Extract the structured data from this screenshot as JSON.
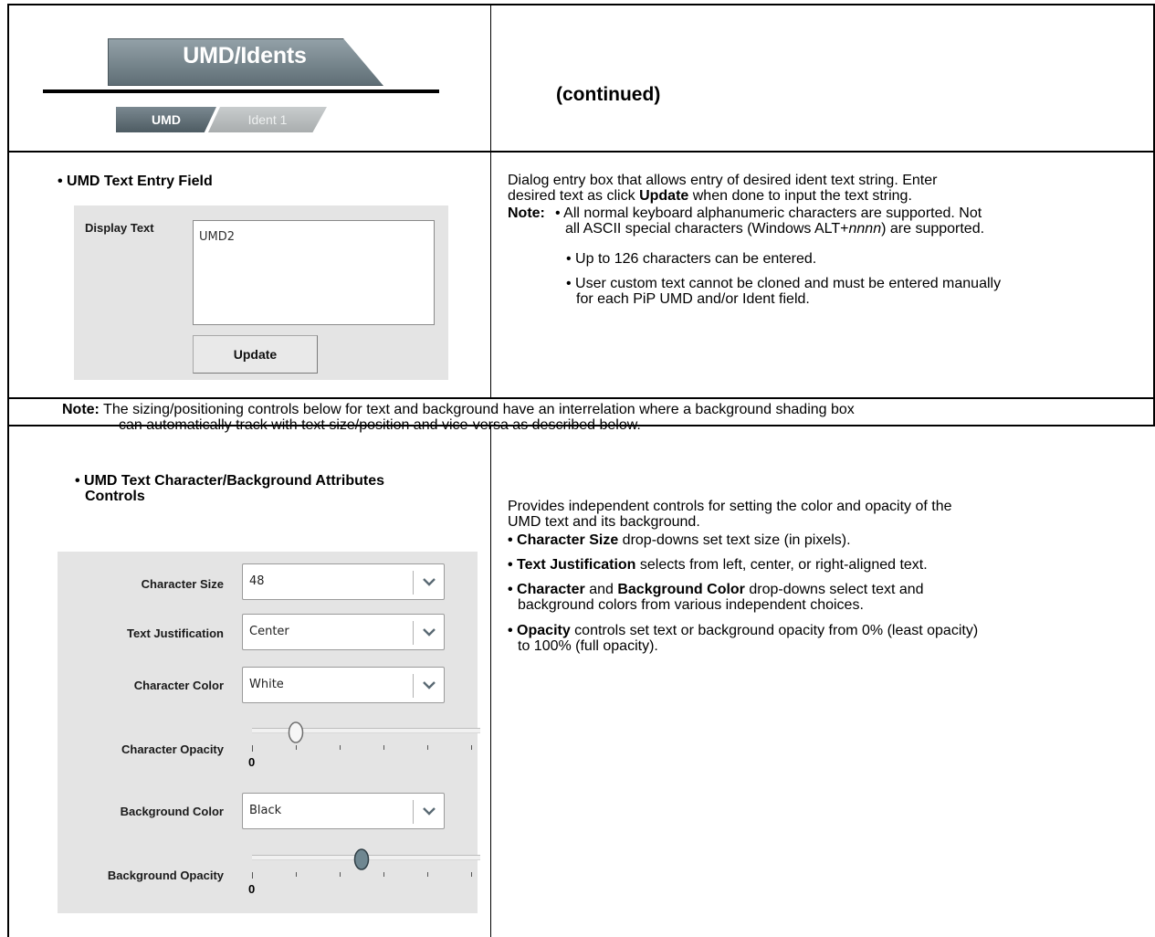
{
  "header": {
    "main_tab": "UMD/Idents",
    "sub_tabs": [
      "UMD",
      "Ident 1"
    ],
    "continued": "(continued)"
  },
  "section1": {
    "title": "• UMD Text Entry Field",
    "field_label": "Display Text",
    "field_value": "UMD2",
    "button": "Update",
    "desc_intro_1": "Dialog entry box that allows entry of desired ident text string. Enter",
    "desc_intro_2a": "desired text as click ",
    "desc_intro_2b": "Update",
    "desc_intro_2c": " when done to input the text string.",
    "note_label": "Note:",
    "note_1a": "• All normal keyboard alphanumeric characters are supported. Not",
    "note_1b_a": "all ASCII special characters (Windows ALT+",
    "note_1b_b": "nnnn",
    "note_1b_c": ") are supported.",
    "note_2": "• Up to 126 characters can be entered.",
    "note_3a": "• User custom text cannot be cloned and must be entered manually",
    "note_3b": "for each PiP UMD and/or Ident field."
  },
  "note_row": {
    "label": "Note:",
    "line1": " The sizing/positioning controls below for text and background have an interrelation where a background shading box",
    "line2": "can automatically track with text size/position and vice-versa as described below."
  },
  "section3": {
    "title_1": "• UMD Text Character/Background Attributes",
    "title_2": "Controls",
    "controls": {
      "char_size": {
        "label": "Character Size",
        "value": "48"
      },
      "text_just": {
        "label": "Text Justification",
        "value": "Center"
      },
      "char_color": {
        "label": "Character Color",
        "value": "White"
      },
      "char_opacity": {
        "label": "Character Opacity",
        "min_label": "0",
        "level_percent": 20
      },
      "bg_color": {
        "label": "Background Color",
        "value": "Black"
      },
      "bg_opacity": {
        "label": "Background Opacity",
        "min_label": "0",
        "level_percent": 50
      }
    },
    "desc_1": "Provides independent controls for setting the color and opacity of the",
    "desc_2": "UMD text and its background.",
    "b1_bold": "• Character Size",
    "b1_rest": " drop-downs set text size (in pixels).",
    "b2_bold": "• Text Justification",
    "b2_rest": " selects from left, center, or right-aligned text.",
    "b3_bold1": "• Character",
    "b3_mid": " and ",
    "b3_bold2": "Background Color",
    "b3_rest": " drop-downs select text and",
    "b3_line2": "background colors from various independent choices.",
    "b4_bold": "• Opacity",
    "b4_rest": " controls set text or background opacity from 0% (least opacity)",
    "b4_line2": "to 100% (full opacity)."
  }
}
